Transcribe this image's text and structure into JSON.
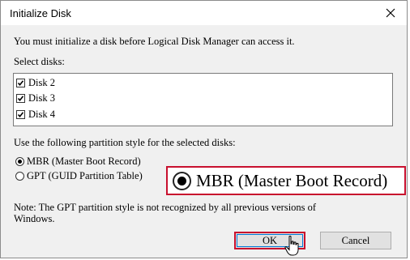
{
  "window": {
    "title": "Initialize Disk"
  },
  "intro_text": "You must initialize a disk before Logical Disk Manager can access it.",
  "select_disks_label": "Select disks:",
  "disks": [
    {
      "label": "Disk 2",
      "checked": true
    },
    {
      "label": "Disk 3",
      "checked": true
    },
    {
      "label": "Disk 4",
      "checked": true
    }
  ],
  "partition_style_label": "Use the following partition style for the selected disks:",
  "partition_options": [
    {
      "label": "MBR (Master Boot Record)",
      "selected": true
    },
    {
      "label": "GPT (GUID Partition Table)",
      "selected": false
    }
  ],
  "zoom_callout": {
    "label": "MBR (Master Boot Record)"
  },
  "note_text": {
    "line1": "Note: The GPT partition style is not recognized by all previous versions of",
    "line2": "Windows."
  },
  "buttons": {
    "ok": "OK",
    "cancel": "Cancel"
  },
  "colors": {
    "highlight_border": "#c8102e",
    "focus_border": "#0078d7"
  }
}
